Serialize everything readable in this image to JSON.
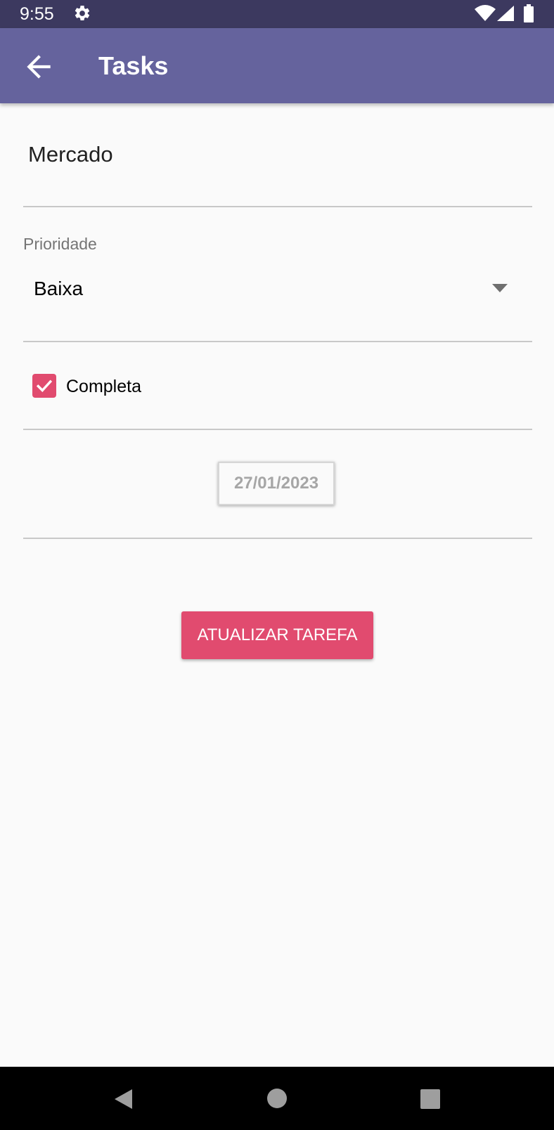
{
  "status_bar": {
    "time": "9:55",
    "icons": [
      "gear-icon",
      "wifi-icon",
      "signal-icon",
      "battery-icon"
    ]
  },
  "app_bar": {
    "title": "Tasks",
    "back_icon": "arrow-left-icon",
    "color": "#65639d"
  },
  "form": {
    "task_name": "Mercado",
    "priority_label": "Prioridade",
    "priority_value": "Baixa",
    "completed_label": "Completa",
    "completed": true,
    "date": "27/01/2023",
    "submit_label": "ATUALIZAR TAREFA"
  },
  "colors": {
    "accent": "#e14b6f",
    "status_bar": "#3c395f",
    "background": "#fafafa"
  },
  "nav_bar": {
    "icons": [
      "nav-back-icon",
      "nav-home-icon",
      "nav-recents-icon"
    ]
  }
}
